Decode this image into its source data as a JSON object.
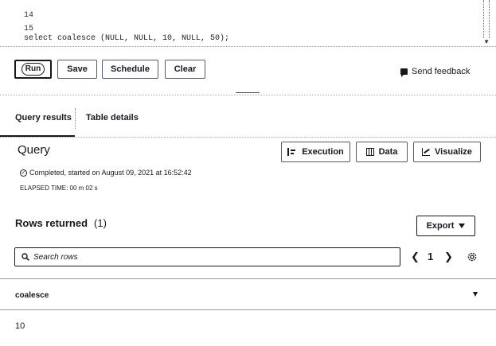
{
  "editor": {
    "lines": [
      {
        "num": "14",
        "code": ""
      },
      {
        "num": "15",
        "code": "select coalesce (NULL, NULL, 10, NULL, 50);"
      }
    ]
  },
  "toolbar": {
    "run_label": "Run",
    "save_label": "Save",
    "schedule_label": "Schedule",
    "clear_label": "Clear",
    "feedback_label": "Send feedback"
  },
  "tabs": [
    {
      "label": "Query results",
      "active": true
    },
    {
      "label": "Table details",
      "active": false
    }
  ],
  "query": {
    "title": "Query",
    "execution_label": "Execution",
    "data_label": "Data",
    "visualize_label": "Visualize",
    "status": "Completed, started on August 09, 2021 at 16:52:42",
    "elapsed": "ELAPSED TIME: 00 m 02 s"
  },
  "results": {
    "title": "Rows returned",
    "count": "(1)",
    "export_label": "Export",
    "search_placeholder": "Search rows",
    "page": "1",
    "columns": [
      "coalesce"
    ],
    "rows": [
      [
        "10"
      ]
    ]
  },
  "icons": {
    "feedback": "feedback-icon",
    "execution": "execution-icon",
    "data": "table-icon",
    "visualize": "chart-icon",
    "status": "check-circle-icon",
    "search": "search-icon",
    "settings": "gear-icon"
  }
}
